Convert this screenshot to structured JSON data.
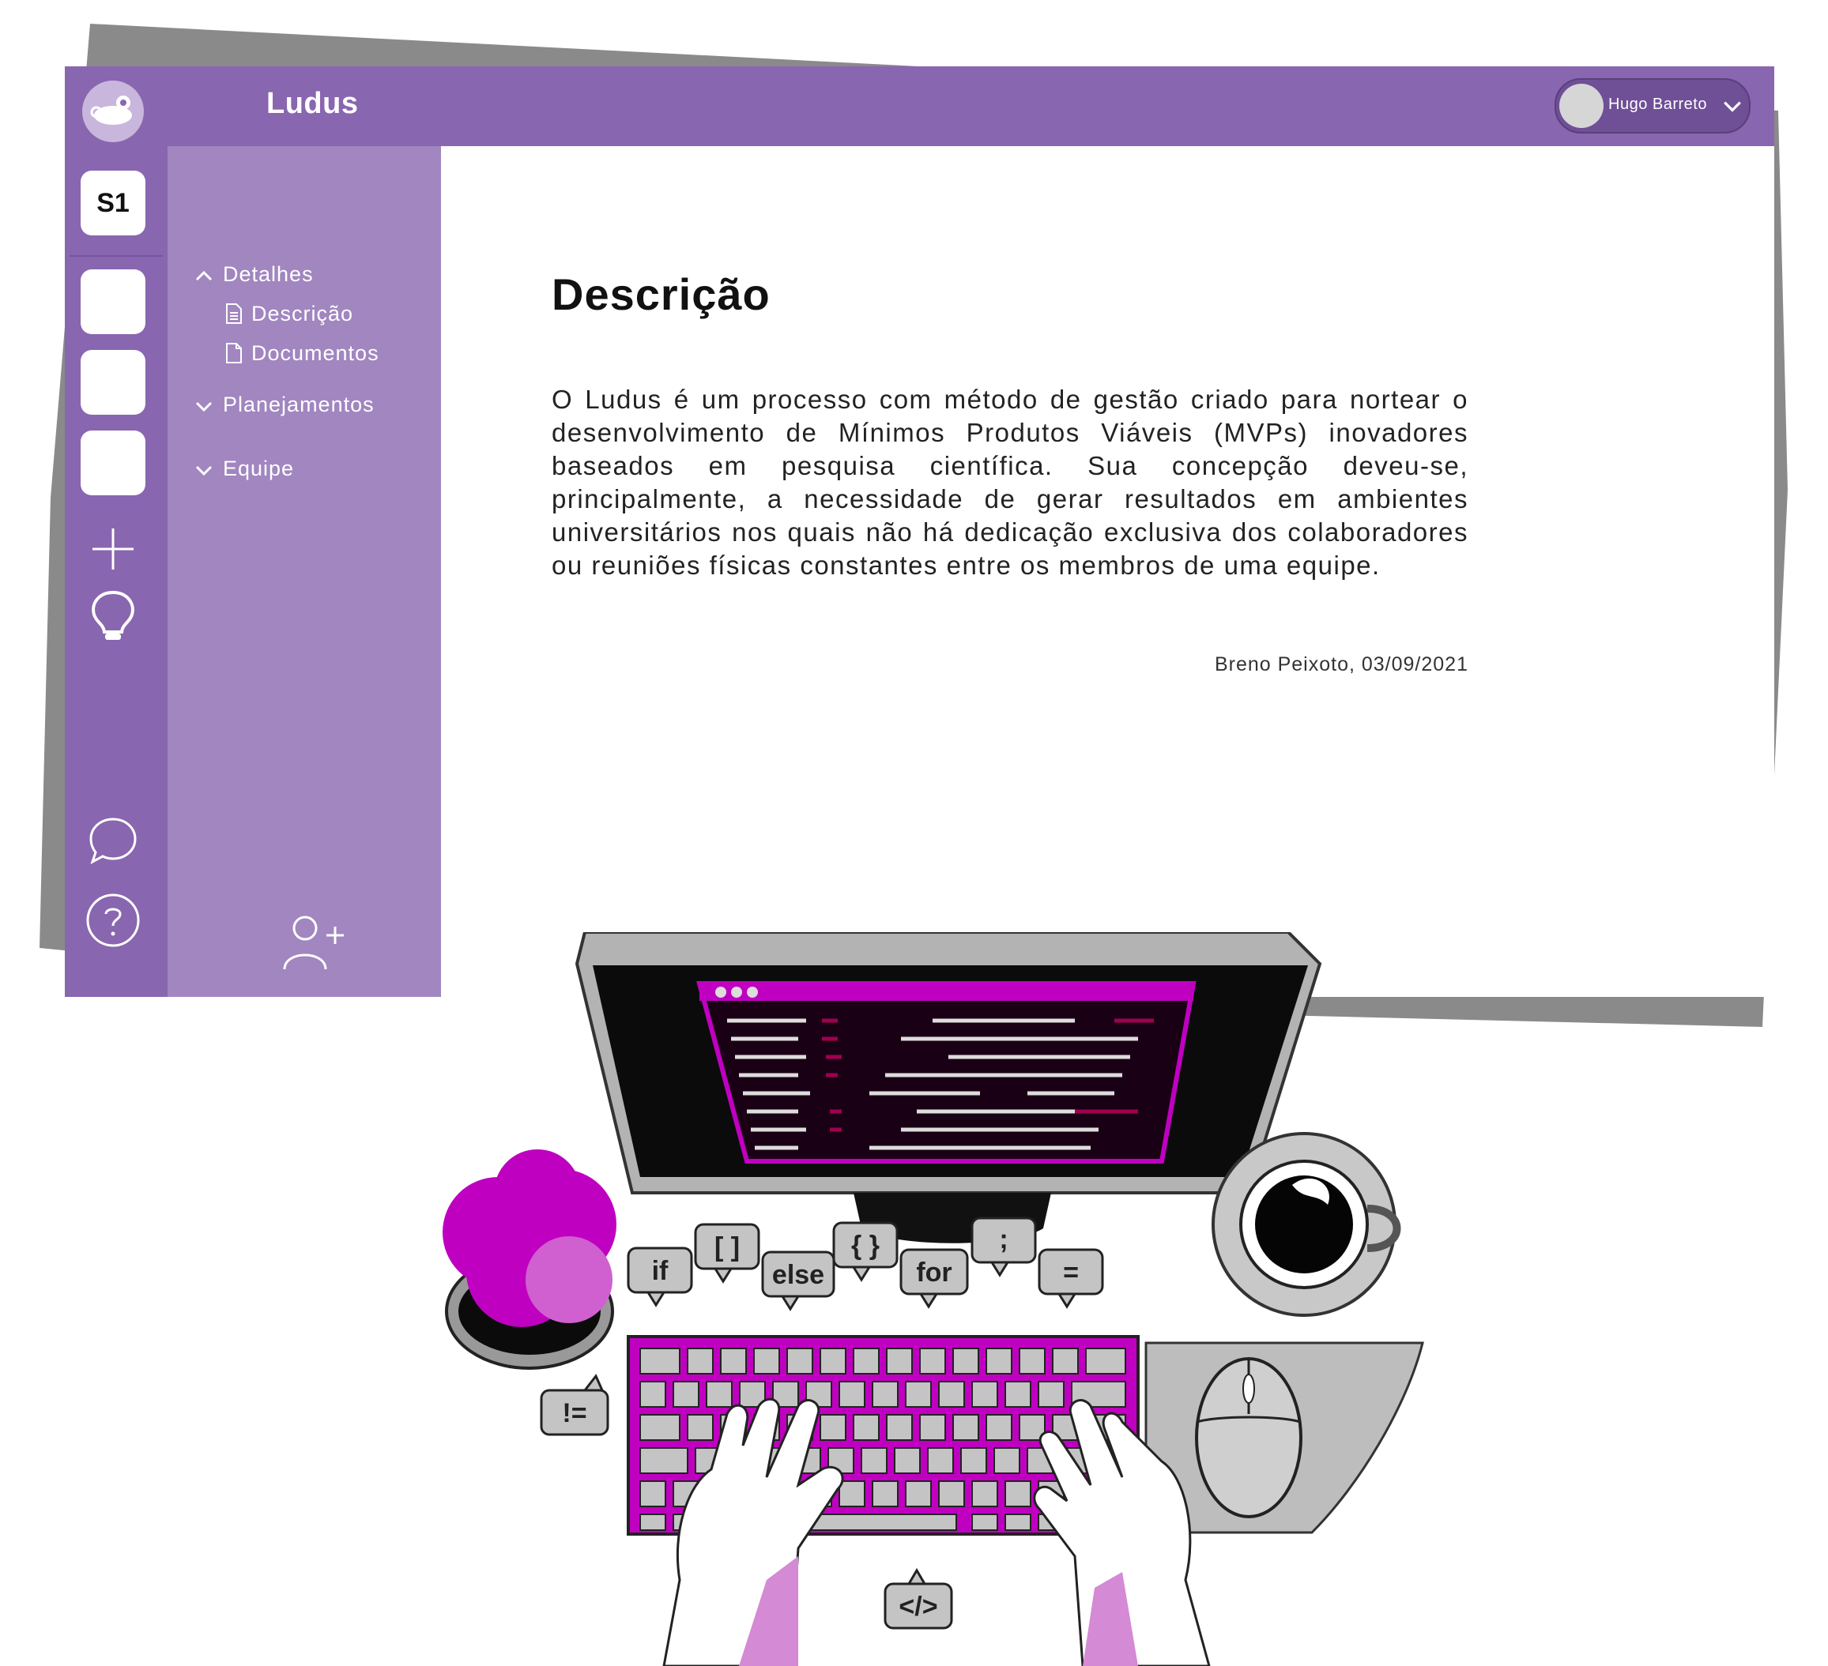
{
  "app": {
    "title": "Ludus",
    "brand_color": "#8966b0",
    "sidebar_color": "#a186c0"
  },
  "user": {
    "name": "Hugo Barreto"
  },
  "rail": {
    "project_badge": "S1",
    "icons": [
      "logo-icon",
      "plus-icon",
      "lightbulb-icon",
      "chat-icon",
      "help-icon"
    ]
  },
  "sidebar": {
    "sections": [
      {
        "label": "Detalhes",
        "expanded": true,
        "children": [
          "Descrição",
          "Documentos"
        ]
      },
      {
        "label": "Planejamentos",
        "expanded": false
      },
      {
        "label": "Equipe",
        "expanded": false
      }
    ]
  },
  "main": {
    "heading": "Descrição",
    "body": "O Ludus é um processo com método de gestão criado para nortear o desenvolvimento de Mínimos Produtos Viáveis (MVPs) inovadores baseados em pesquisa científica. Sua concepção deveu-se, principalmente, a necessidade de gerar resultados em ambientes universitários nos quais não há dedicação exclusiva dos colaboradores ou reuniões físicas constantes entre os membros de uma equipe.",
    "author": "Breno Peixoto, 03/09/2021"
  },
  "illustration": {
    "bubbles": [
      "if",
      "[ ]",
      "else",
      "{ }",
      "for",
      ";",
      "=",
      "!=",
      "</>"
    ]
  }
}
